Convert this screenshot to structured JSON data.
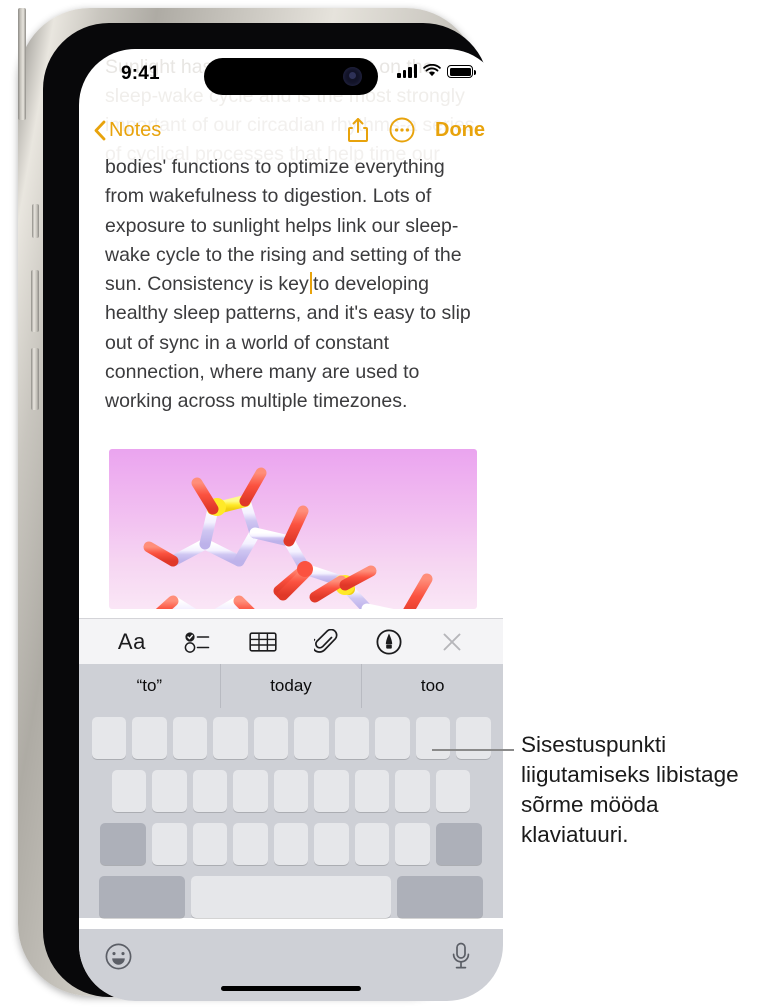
{
  "device": {
    "name": "iphone-15-pro",
    "frame_color": "#c9c6bf"
  },
  "status_bar": {
    "time": "9:41",
    "cellular_icon": "signal-bars-icon",
    "wifi_icon": "wifi-icon",
    "battery_icon": "battery-full-icon",
    "signal_bars": 4,
    "battery_level": 100
  },
  "nav_bar": {
    "back_icon": "chevron-left-icon",
    "back_label": "Notes",
    "share_icon": "share-icon",
    "more_icon": "more-ellipsis-circle-icon",
    "done_label": "Done",
    "accent_color": "#E8A30C"
  },
  "ghost_text": {
    "line1": "Sunlight has a profound impact on the",
    "line2": "sleep-wake cycle and is the most strongly",
    "line3": "important of our circadian rhythms-a series",
    "line4": "of cyclical processes that help time our"
  },
  "note": {
    "body_before_caret": "bodies' functions to optimize everything from wakefulness to digestion. Lots of exposure to sunlight helps link our sleep-wake cycle to the rising and setting of the sun. Consistency is key",
    "caret": "text-cursor",
    "body_after_caret": "to developing healthy sleep patterns, and it's easy to slip out of sync in a world of constant connection, where many are used to working across multiple timezones.",
    "text_color": "#3b3b3d",
    "attachment": {
      "name": "molecule-image",
      "description": "3D ball-and-stick molecular model on pink gradient",
      "gradient_top": "#eaa4ef",
      "gradient_bottom": "#fae6f6"
    }
  },
  "keyboard": {
    "toolbar": [
      {
        "name": "format-aa-button",
        "label": "Aa",
        "icon": "format-text-icon"
      },
      {
        "name": "checklist-button",
        "label": "",
        "icon": "checklist-icon"
      },
      {
        "name": "table-button",
        "label": "",
        "icon": "table-icon"
      },
      {
        "name": "attach-button",
        "label": "",
        "icon": "paperclip-icon"
      },
      {
        "name": "markup-button",
        "label": "",
        "icon": "markup-pen-icon"
      },
      {
        "name": "close-toolbar-button",
        "label": "",
        "icon": "close-x-icon"
      }
    ],
    "predictions": [
      "“to”",
      "today",
      "too"
    ],
    "row1_keys": 10,
    "row2_keys": 9,
    "row3_letter_keys": 7,
    "shift_key": "shift-key",
    "delete_key": "delete-key",
    "numbers_key": "123-key",
    "space_key": "space-key",
    "return_key": "return-key",
    "emoji_icon": "emoji-smiley-icon",
    "dictation_icon": "microphone-icon",
    "key_color": "#E6E7EA",
    "modifier_color": "#ADB0B9",
    "background_color": "#CED0D6"
  },
  "callout": {
    "text": "Sisestuspunkti liigutamiseks libistage sõrme mööda klaviatuuri.",
    "leader_line": "callout-leader-line"
  }
}
